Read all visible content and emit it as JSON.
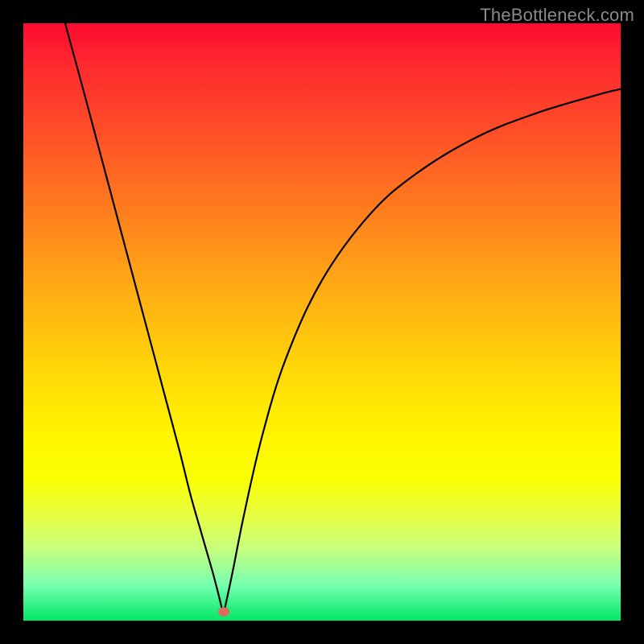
{
  "watermark": "TheBottleneck.com",
  "marker": {
    "x_frac": 0.335,
    "y_frac": 0.985,
    "color": "#e16a5f"
  },
  "chart_data": {
    "type": "line",
    "title": "",
    "xlabel": "",
    "ylabel": "",
    "xlim": [
      0,
      100
    ],
    "ylim": [
      0,
      100
    ],
    "grid": false,
    "legend": false,
    "series": [
      {
        "name": "left-branch",
        "x": [
          7,
          10,
          14,
          18,
          22,
          26,
          28,
          30,
          32,
          33.5
        ],
        "y": [
          100,
          89,
          74,
          59,
          44,
          29,
          21,
          14,
          7,
          1
        ]
      },
      {
        "name": "right-branch",
        "x": [
          33.5,
          35,
          37,
          40,
          44,
          50,
          58,
          66,
          76,
          86,
          96,
          100
        ],
        "y": [
          1,
          8,
          18,
          31,
          44,
          57,
          68,
          75,
          81,
          85,
          88,
          89
        ]
      }
    ],
    "marker_point": {
      "x": 33.5,
      "y": 1.5
    },
    "background_gradient": {
      "direction": "top_to_bottom",
      "stops": [
        {
          "pos": 0.0,
          "color": "#fd0b30"
        },
        {
          "pos": 0.2,
          "color": "#ff5526"
        },
        {
          "pos": 0.42,
          "color": "#ffa316"
        },
        {
          "pos": 0.68,
          "color": "#fff300"
        },
        {
          "pos": 0.88,
          "color": "#c6ff7e"
        },
        {
          "pos": 1.0,
          "color": "#00e763"
        }
      ]
    }
  }
}
